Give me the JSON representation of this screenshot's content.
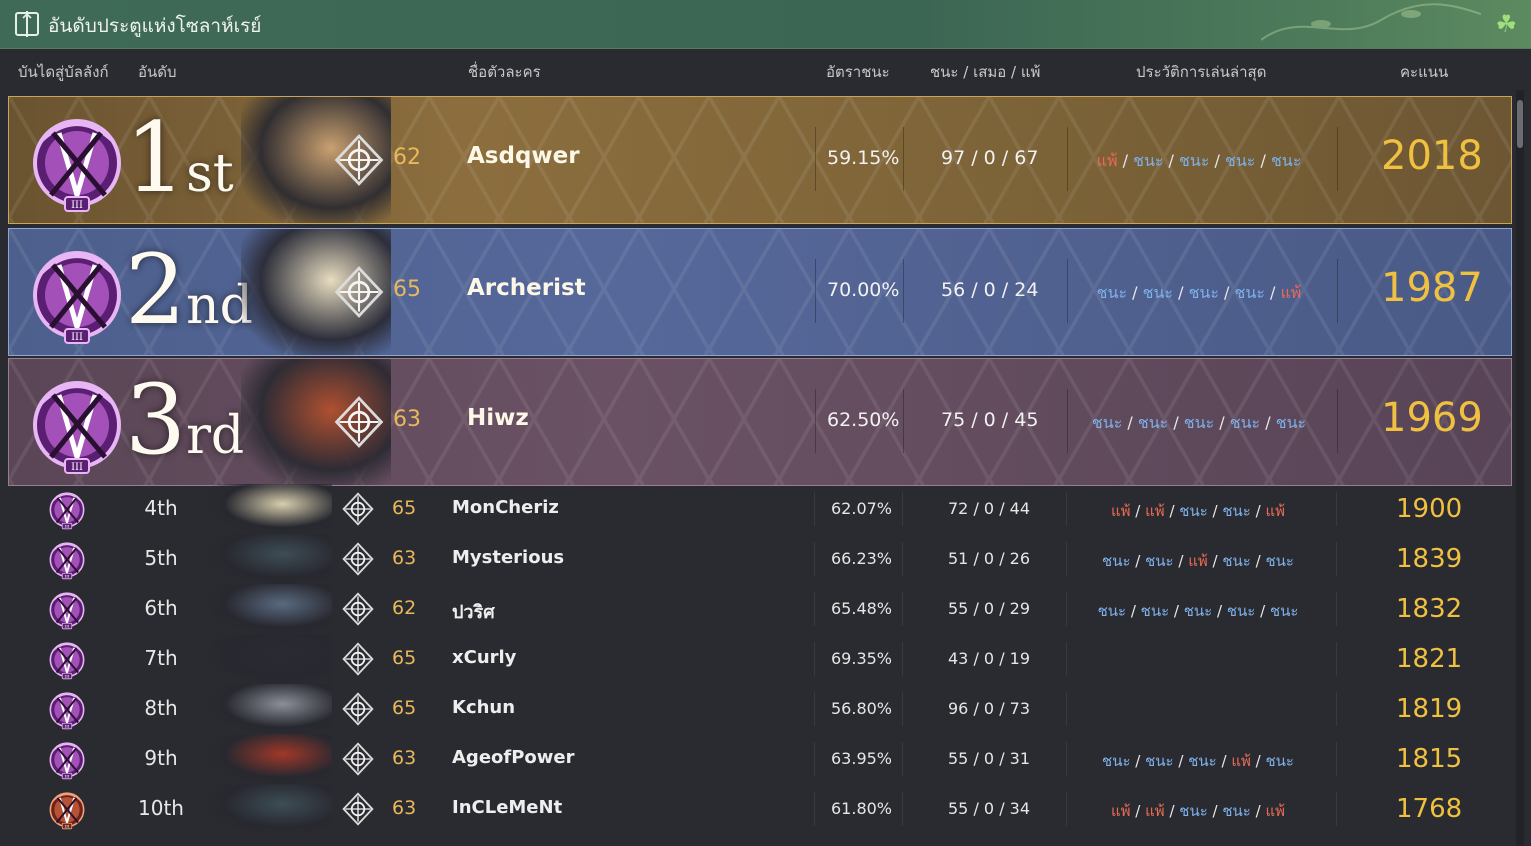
{
  "window": {
    "title": "อันดับประตูแห่งโซลาห์เรย์",
    "icon": "bookmark-sword-icon",
    "corner_icon": "clover-icon"
  },
  "columns": {
    "tier": "บันไดสู่บัลลังก์",
    "rank": "อันดับ",
    "character": "ชื่อตัวละคร",
    "win_rate": "อัตราชนะ",
    "wdl": "ชนะ / เสมอ / แพ้",
    "history": "ประวัติการเล่นล่าสุด",
    "score": "คะแนน"
  },
  "labels": {
    "win": "ชนะ",
    "loss": "แพ้",
    "slash": " / "
  },
  "colors": {
    "gold": "#f0c040",
    "level": "#e8b85a",
    "win": "#7fb1ea",
    "loss": "#e86a55"
  },
  "top": [
    {
      "rank_num": "1",
      "rank_suffix": "st",
      "level": "62",
      "name": "Asdqwer",
      "rate": "59.15%",
      "wins": "97",
      "draws": "0",
      "losses": "67",
      "score": "2018",
      "class_icon": "class-emblem-wings-icon",
      "history": [
        "loss",
        "win",
        "win",
        "win",
        "win"
      ]
    },
    {
      "rank_num": "2",
      "rank_suffix": "nd",
      "level": "65",
      "name": "Archerist",
      "rate": "70.00%",
      "wins": "56",
      "draws": "0",
      "losses": "24",
      "score": "1987",
      "class_icon": "class-emblem-star-icon",
      "history": [
        "win",
        "win",
        "win",
        "win",
        "loss"
      ]
    },
    {
      "rank_num": "3",
      "rank_suffix": "rd",
      "level": "63",
      "name": "Hiwz",
      "rate": "62.50%",
      "wins": "75",
      "draws": "0",
      "losses": "45",
      "score": "1969",
      "class_icon": "class-emblem-crescent-icon",
      "history": [
        "win",
        "win",
        "win",
        "win",
        "win"
      ]
    }
  ],
  "rows": [
    {
      "rank": "4th",
      "level": "65",
      "name": "MonCheriz",
      "rate": "62.07%",
      "wins": "72",
      "draws": "0",
      "losses": "44",
      "score": "1900",
      "history": [
        "loss",
        "loss",
        "win",
        "win",
        "loss"
      ]
    },
    {
      "rank": "5th",
      "level": "63",
      "name": "Mysterious",
      "rate": "66.23%",
      "wins": "51",
      "draws": "0",
      "losses": "26",
      "score": "1839",
      "history": [
        "win",
        "win",
        "loss",
        "win",
        "win"
      ]
    },
    {
      "rank": "6th",
      "level": "62",
      "name": "ปวริศ",
      "rate": "65.48%",
      "wins": "55",
      "draws": "0",
      "losses": "29",
      "score": "1832",
      "history": [
        "win",
        "win",
        "win",
        "win",
        "win"
      ]
    },
    {
      "rank": "7th",
      "level": "65",
      "name": "xCurly",
      "rate": "69.35%",
      "wins": "43",
      "draws": "0",
      "losses": "19",
      "score": "1821",
      "history": []
    },
    {
      "rank": "8th",
      "level": "65",
      "name": "Kchun",
      "rate": "56.80%",
      "wins": "96",
      "draws": "0",
      "losses": "73",
      "score": "1819",
      "history": []
    },
    {
      "rank": "9th",
      "level": "63",
      "name": "AgeofPower",
      "rate": "63.95%",
      "wins": "55",
      "draws": "0",
      "losses": "31",
      "score": "1815",
      "history": [
        "win",
        "win",
        "win",
        "loss",
        "win"
      ]
    },
    {
      "rank": "10th",
      "level": "63",
      "name": "InCLeMeNt",
      "rate": "61.80%",
      "wins": "55",
      "draws": "0",
      "losses": "34",
      "score": "1768",
      "history": [
        "loss",
        "loss",
        "win",
        "win",
        "loss"
      ]
    }
  ]
}
